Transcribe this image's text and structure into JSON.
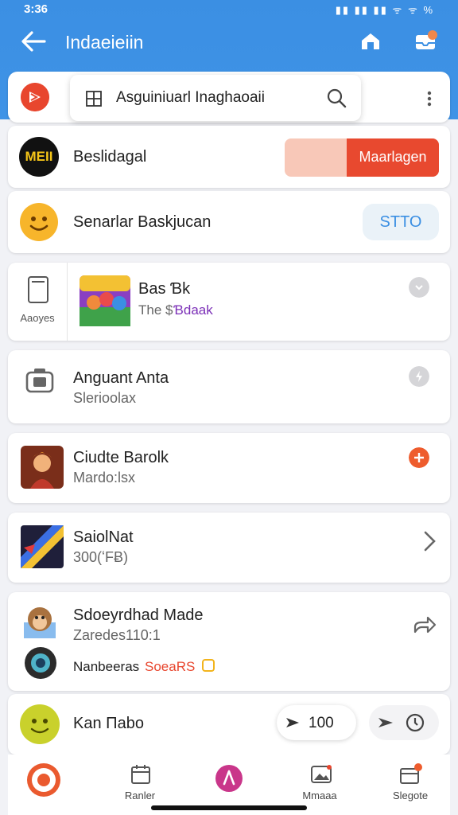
{
  "status_bar": {
    "time": "3:36",
    "icons": "▮▮ ▮▮ ▮▮  ᯤ ᯤ %"
  },
  "header": {
    "title": "Indaeieiin"
  },
  "search": {
    "query": "Asguiniuarl Inaghaoaii"
  },
  "rows": [
    {
      "logo_text": "MEII",
      "title": "Beslidagal",
      "action": "Maarlagen"
    },
    {
      "title": "Senarlar Baskjucan",
      "action": "STTO"
    },
    {
      "side_label": "Aaoyes",
      "title": "Bas Ɓk",
      "subtitle": "The $",
      "badge": "Ɓdaak"
    },
    {
      "title": "Anguant Anta",
      "subtitle": "Slerioolax"
    },
    {
      "title": "Ciudte Barolk",
      "subtitle": "Mardo:lsx"
    },
    {
      "title": "SaiolNat",
      "subtitle": "300(ʻFɃ)"
    },
    {
      "title": "Sdoeyrdhad Made",
      "subtitle": "Zaredes110:1",
      "extra_label": "Nanbeeras",
      "extra_link": "SoeaRS"
    },
    {
      "title": "Kan Πabo",
      "amount": "100"
    }
  ],
  "bottom_nav": [
    {
      "label": "",
      "icon": "app-logo-icon"
    },
    {
      "label": "Ranler",
      "icon": "calendar-icon"
    },
    {
      "label": "",
      "icon": "compass-icon"
    },
    {
      "label": "Mmaaa",
      "icon": "image-icon"
    },
    {
      "label": "Slegote",
      "icon": "box-icon"
    }
  ],
  "colors": {
    "primary": "#3b8fe3",
    "accent": "#e8462e",
    "card": "#ffffff"
  }
}
